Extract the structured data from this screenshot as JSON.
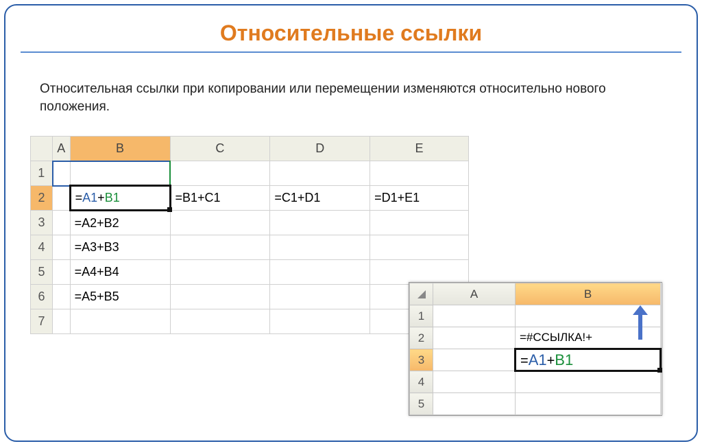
{
  "title": "Относительные ссылки",
  "subtitle": "Относительная ссылки при копировании или перемещении изменяются относительно нового положения.",
  "big_sheet": {
    "cols": [
      "A",
      "B",
      "C",
      "D",
      "E"
    ],
    "rows": [
      "1",
      "2",
      "3",
      "4",
      "5",
      "6",
      "7"
    ],
    "b2_prefix": "=",
    "b2_refA": "A1",
    "b2_plus": "+",
    "b2_refB": "B1",
    "c2": "=B1+C1",
    "d2": "=C1+D1",
    "e2": "=D1+E1",
    "b3": "=A2+B2",
    "b4": "=A3+B3",
    "b5": "=A4+B4",
    "b6": "=A5+B5"
  },
  "small_sheet": {
    "cols": [
      "A",
      "B"
    ],
    "rows": [
      "1",
      "2",
      "3",
      "4",
      "5"
    ],
    "b2": "=#ССЫЛКА!+",
    "b3_prefix": "=",
    "b3_refA": "A1",
    "b3_plus": "+",
    "b3_refB": "B1"
  }
}
